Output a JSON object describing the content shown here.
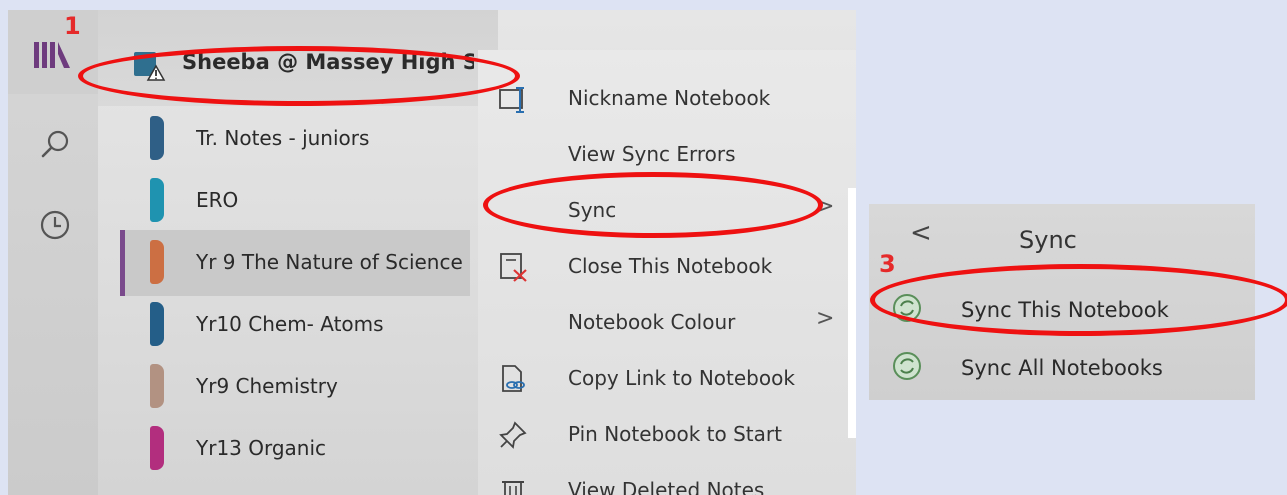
{
  "colors": {
    "annotation": "#ee1111",
    "selected_bar": "#7a4a8c"
  },
  "rail": {
    "icons": [
      "onenote-logo-icon",
      "search-icon",
      "recent-clock-icon"
    ]
  },
  "header": {
    "title": "Sheeba @ Massey High School",
    "icon": "notebook-warning-icon"
  },
  "notebooks": [
    {
      "label": "Tr. Notes - juniors",
      "color": "#2f5f86",
      "selected": false
    },
    {
      "label": "ERO",
      "color": "#1f93b0",
      "selected": false
    },
    {
      "label": "Yr 9 The Nature of Science",
      "color": "#cc6f43",
      "selected": true
    },
    {
      "label": "Yr10 Chem- Atoms",
      "color": "#245e88",
      "selected": false
    },
    {
      "label": "Yr9 Chemistry",
      "color": "#b29282",
      "selected": false
    },
    {
      "label": "Yr13 Organic",
      "color": "#b22e7e",
      "selected": false
    }
  ],
  "context_menu": {
    "items": [
      {
        "label": "Nickname Notebook",
        "icon": "rename-icon"
      },
      {
        "label": "View Sync Errors",
        "icon": ""
      },
      {
        "label": "Sync",
        "icon": "",
        "chevron": ">"
      },
      {
        "label": "Close This Notebook",
        "icon": "close-notebook-icon"
      },
      {
        "label": "Notebook Colour",
        "icon": "",
        "chevron": ">"
      },
      {
        "label": "Copy Link to Notebook",
        "icon": "copy-link-icon"
      },
      {
        "label": "Pin Notebook to Start",
        "icon": "pin-icon"
      },
      {
        "label": "View Deleted Notes",
        "icon": "trash-icon"
      }
    ]
  },
  "sync_panel": {
    "back": "<",
    "title": "Sync",
    "items": [
      {
        "label": "Sync This Notebook",
        "icon": "sync-icon"
      },
      {
        "label": "Sync All Notebooks",
        "icon": "sync-icon"
      }
    ]
  },
  "annotations": {
    "step1": "1",
    "step3": "3"
  }
}
